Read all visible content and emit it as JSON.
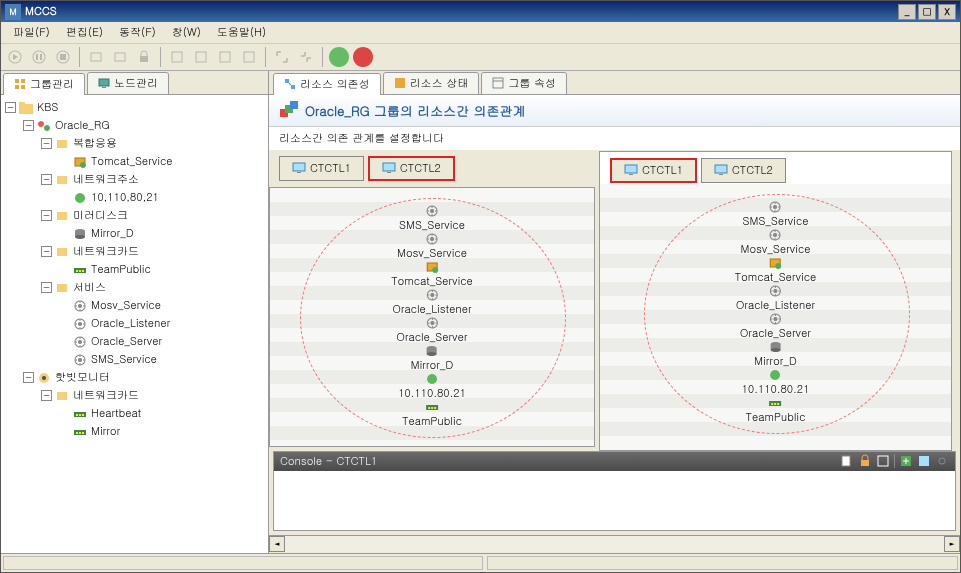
{
  "window": {
    "title": "MCCS"
  },
  "menubar": [
    "파일(F)",
    "편집(E)",
    "동작(F)",
    "창(W)",
    "도움말(H)"
  ],
  "left_tabs": {
    "group": "그룹관리",
    "node": "노드관리"
  },
  "tree": {
    "root": "KBS",
    "group": "Oracle_RG",
    "items": [
      {
        "label": "복합응용",
        "children": [
          "Tomcat_Service"
        ]
      },
      {
        "label": "네트워크주소",
        "children": [
          "10,110,80,21"
        ]
      },
      {
        "label": "미러디스크",
        "children": [
          "Mirror_D"
        ]
      },
      {
        "label": "네트워크카드",
        "children": [
          "TeamPublic"
        ]
      },
      {
        "label": "서비스",
        "children": [
          "Mosv_Service",
          "Oracle_Listener",
          "Oracle_Server",
          "SMS_Service"
        ]
      }
    ],
    "hotbit": "핫빗모니터",
    "hotbit_nc": "네트워크카드",
    "hotbit_children": [
      "Heartbeat",
      "Mirror"
    ]
  },
  "right_tabs": [
    "리소스 의존성",
    "리소스 상태",
    "그룹 속성"
  ],
  "content": {
    "title": "Oracle_RG 그룹의 리소스간 의존관계",
    "desc": "리소스간 의존 관계를 설정합니다"
  },
  "nodes_left": [
    "CTCTL1",
    "CTCTL2"
  ],
  "nodes_right": [
    "CTCTL1",
    "CTCTL2"
  ],
  "resources": [
    "SMS_Service",
    "Mosv_Service",
    "Tomcat_Service",
    "Oracle_Listener",
    "Oracle_Server",
    "Mirror_D",
    "10.110.80.21",
    "TeamPublic"
  ],
  "console": {
    "title": "Console - CTCTL1"
  }
}
